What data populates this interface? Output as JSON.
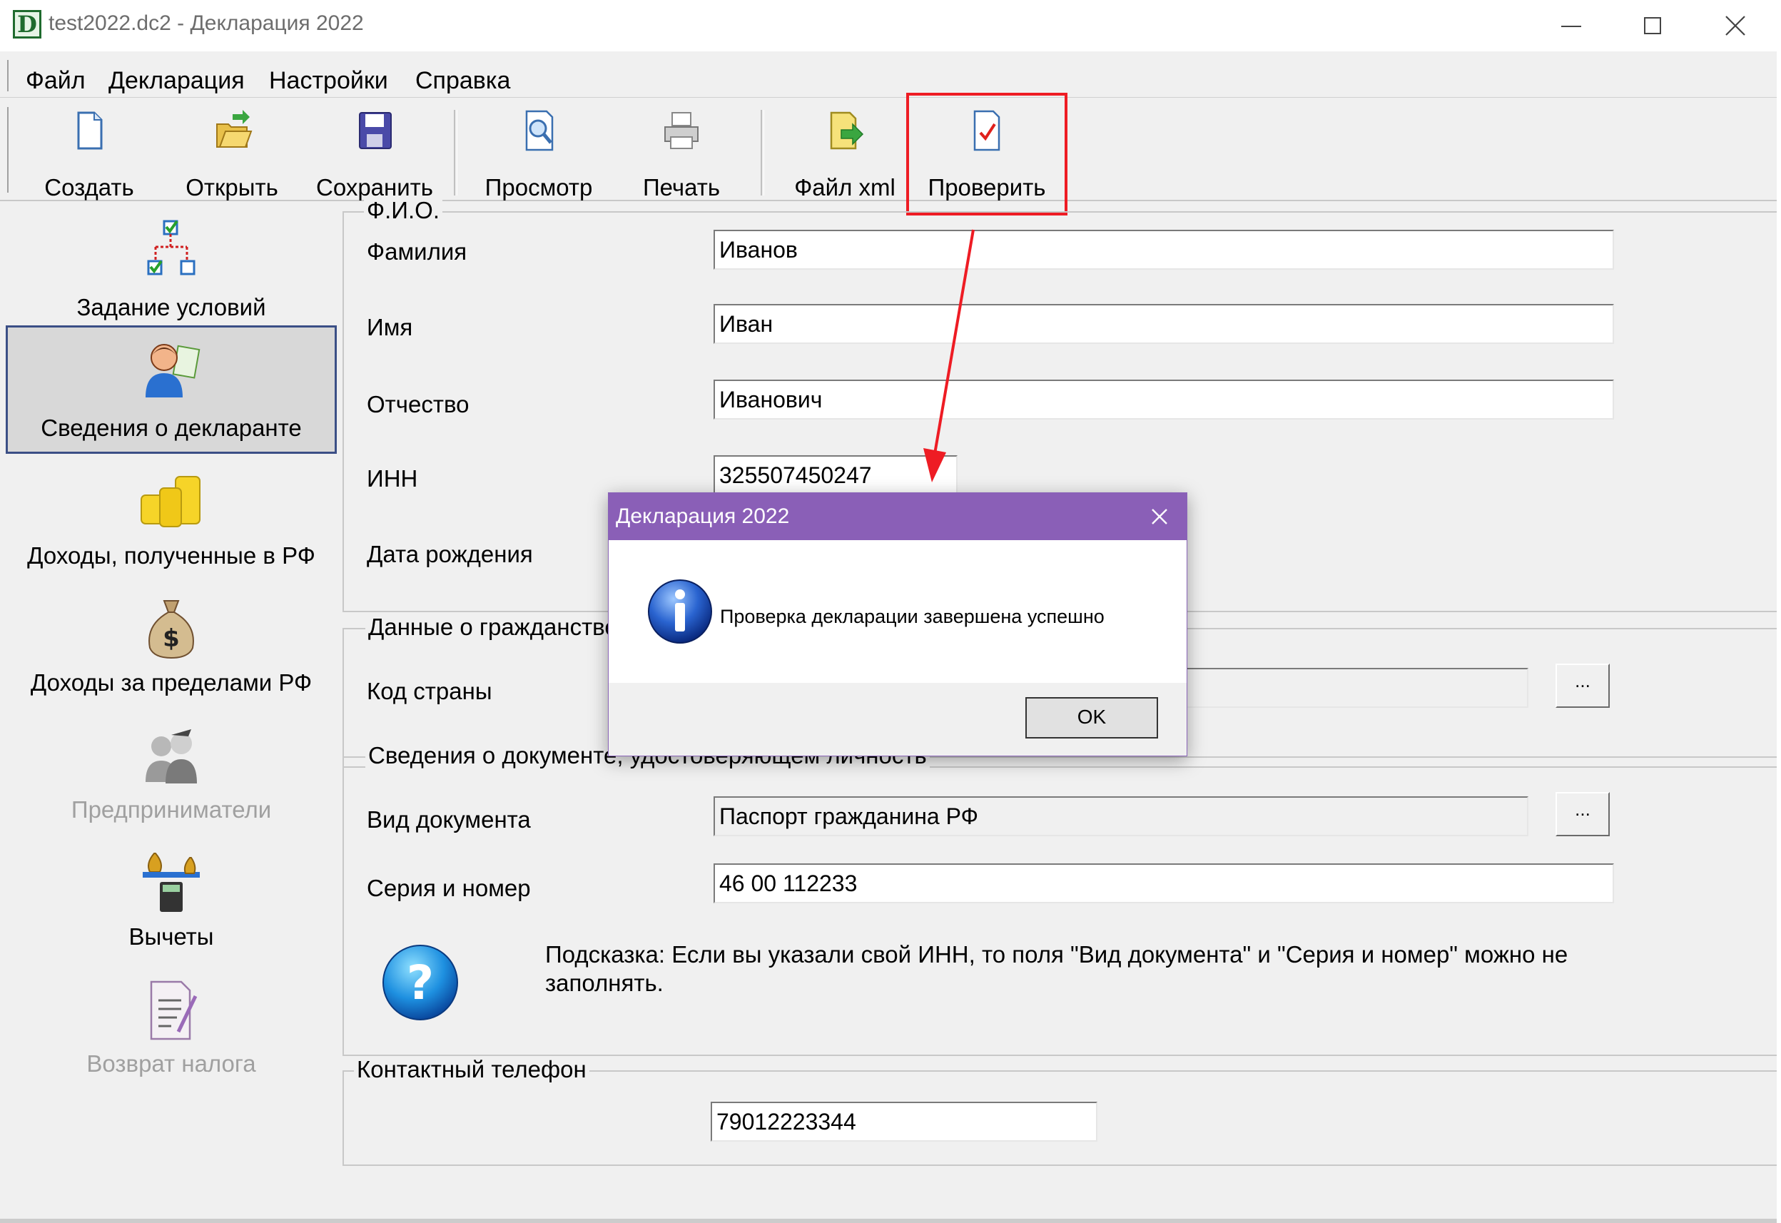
{
  "window": {
    "title": "test2022.dc2 - Декларация 2022",
    "app_icon_letter": "D"
  },
  "menu": [
    "Файл",
    "Декларация",
    "Настройки",
    "Справка"
  ],
  "toolbar": {
    "create": "Создать",
    "open": "Открыть",
    "save": "Сохранить",
    "preview": "Просмотр",
    "print": "Печать",
    "xml": "Файл xml",
    "check": "Проверить"
  },
  "sidebar": [
    {
      "label": "Задание условий",
      "icon": "conditions-icon",
      "active": false,
      "disabled": false
    },
    {
      "label": "Сведения о декларанте",
      "icon": "declarant-icon",
      "active": true,
      "disabled": false
    },
    {
      "label": "Доходы, полученные в РФ",
      "icon": "coins-icon",
      "active": false,
      "disabled": false
    },
    {
      "label": "Доходы за пределами РФ",
      "icon": "money-bag-icon",
      "active": false,
      "disabled": false
    },
    {
      "label": "Предприниматели",
      "icon": "entrepreneurs-icon",
      "active": false,
      "disabled": true
    },
    {
      "label": "Вычеты",
      "icon": "deductions-icon",
      "active": false,
      "disabled": false
    },
    {
      "label": "Возврат налога",
      "icon": "tax-refund-icon",
      "active": false,
      "disabled": true
    }
  ],
  "fio": {
    "legend": "Ф.И.О.",
    "surname_label": "Фамилия",
    "surname": "Иванов",
    "name_label": "Имя",
    "name": "Иван",
    "patronymic_label": "Отчество",
    "patronymic": "Иванович",
    "inn_label": "ИНН",
    "inn": "325507450247",
    "birth_label": "Дата рождения"
  },
  "citizenship": {
    "legend": "Данные о гражданстве",
    "country_label": "Код страны",
    "dots": "..."
  },
  "document": {
    "legend": "Сведения о документе, удостоверяющем личность",
    "type_label": "Вид документа",
    "type": "Паспорт гражданина РФ",
    "number_label": "Серия и номер",
    "number": "46 00 112233",
    "dots": "...",
    "hint": "Подсказка: Если вы указали свой ИНН, то поля \"Вид документа\" и \"Серия и номер\" можно не заполнять."
  },
  "contact": {
    "legend": "Контактный телефон",
    "phone": "79012223344"
  },
  "dialog": {
    "title": "Декларация 2022",
    "message": "Проверка декларации завершена успешно",
    "ok": "OK"
  },
  "colors": {
    "dialog_title": "#8a5fb7",
    "highlight": "#ee1c24",
    "active_border": "#3b4f86"
  }
}
